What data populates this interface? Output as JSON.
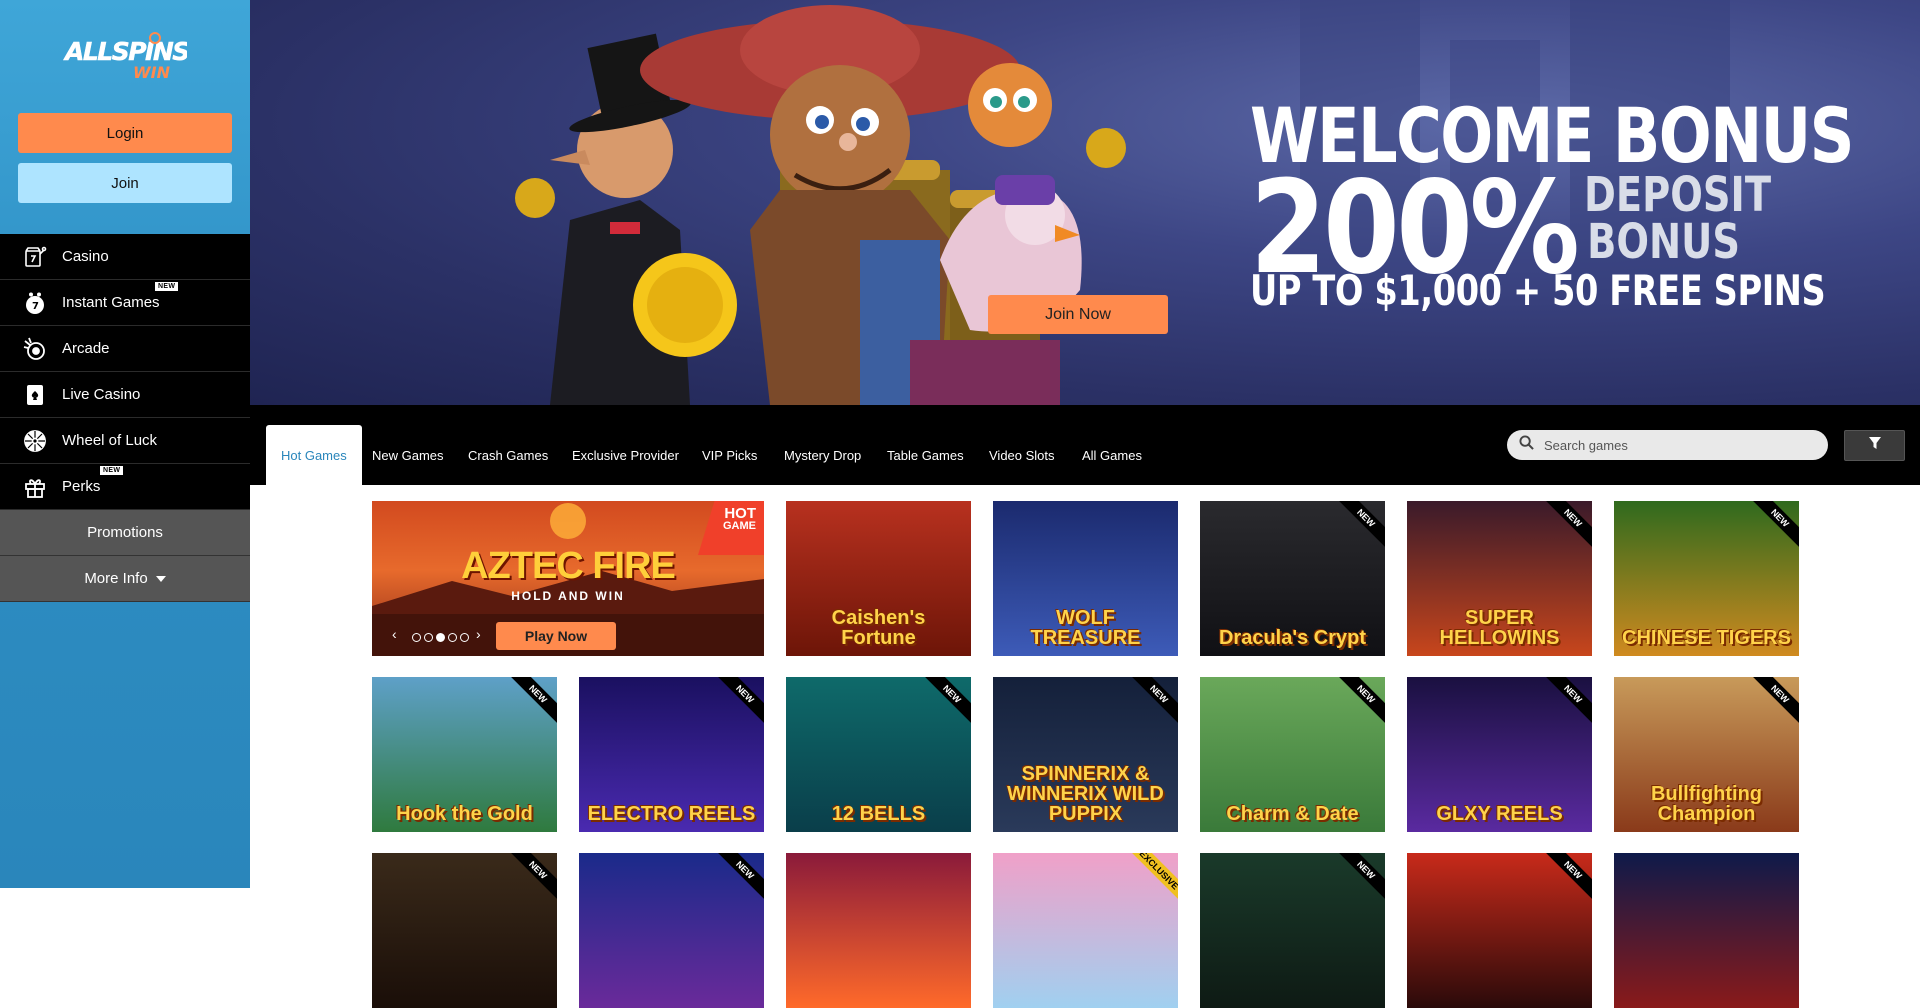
{
  "brand": {
    "logo_top": "ALLSPINS",
    "logo_bottom": "WIN"
  },
  "auth": {
    "login_label": "Login",
    "join_label": "Join"
  },
  "nav": {
    "items": [
      {
        "label": "Casino",
        "icon": "casino-icon"
      },
      {
        "label": "Instant Games",
        "icon": "instant-games-icon",
        "badge": "NEW"
      },
      {
        "label": "Arcade",
        "icon": "arcade-icon"
      },
      {
        "label": "Live Casino",
        "icon": "live-casino-icon"
      },
      {
        "label": "Wheel of Luck",
        "icon": "wheel-icon"
      },
      {
        "label": "Perks",
        "icon": "perks-icon",
        "badge": "NEW"
      }
    ],
    "promotions_label": "Promotions",
    "more_info_label": "More Info"
  },
  "hero": {
    "line1": "WELCOME BONUS",
    "percent": "200%",
    "deposit": "DEPOSIT",
    "bonus": "BONUS",
    "line3": "UP TO $1,000 + 50 FREE SPINS",
    "cta_label": "Join Now"
  },
  "tabs": [
    {
      "label": "Hot Games",
      "active": true
    },
    {
      "label": "New Games"
    },
    {
      "label": "Crash Games"
    },
    {
      "label": "Exclusive Provider"
    },
    {
      "label": "VIP Picks"
    },
    {
      "label": "Mystery Drop"
    },
    {
      "label": "Table Games"
    },
    {
      "label": "Video Slots"
    },
    {
      "label": "All Games"
    }
  ],
  "search": {
    "placeholder": "Search games"
  },
  "featured": {
    "badge_top": "HOT",
    "badge_bottom": "GAME",
    "title": "AZTEC FIRE",
    "subtitle": "HOLD AND WIN",
    "play_label": "Play Now",
    "slides": 5,
    "active_slide": 3
  },
  "games": [
    {
      "name": "Caishen's Fortune"
    },
    {
      "name": "WOLF TREASURE"
    },
    {
      "name": "Dracula's Crypt",
      "badge": "NEW"
    },
    {
      "name": "SUPER HELLOWINS",
      "badge": "NEW"
    },
    {
      "name": "CHINESE TIGERS",
      "badge": "NEW"
    },
    {
      "name": "Hook the Gold",
      "badge": "NEW"
    },
    {
      "name": "ELECTRO REELS",
      "badge": "NEW"
    },
    {
      "name": "12 BELLS",
      "badge": "NEW"
    },
    {
      "name": "SPINNERIX & WINNERIX WILD PUPPIX",
      "badge": "NEW"
    },
    {
      "name": "Charm & Date",
      "badge": "NEW"
    },
    {
      "name": "GLXY REELS",
      "badge": "NEW"
    },
    {
      "name": "Bullfighting Champion",
      "badge": "NEW"
    },
    {
      "name": "",
      "badge": "NEW"
    },
    {
      "name": "",
      "badge": "NEW"
    },
    {
      "name": ""
    },
    {
      "name": "",
      "badge": "EXCLUSIVE"
    },
    {
      "name": "",
      "badge": "NEW"
    },
    {
      "name": "",
      "badge": "NEW"
    },
    {
      "name": ""
    }
  ],
  "colors": {
    "accent": "#ff8a4d",
    "join": "#aee4ff",
    "sidebar": "#2e8fc4",
    "nav_bg": "#000000"
  }
}
